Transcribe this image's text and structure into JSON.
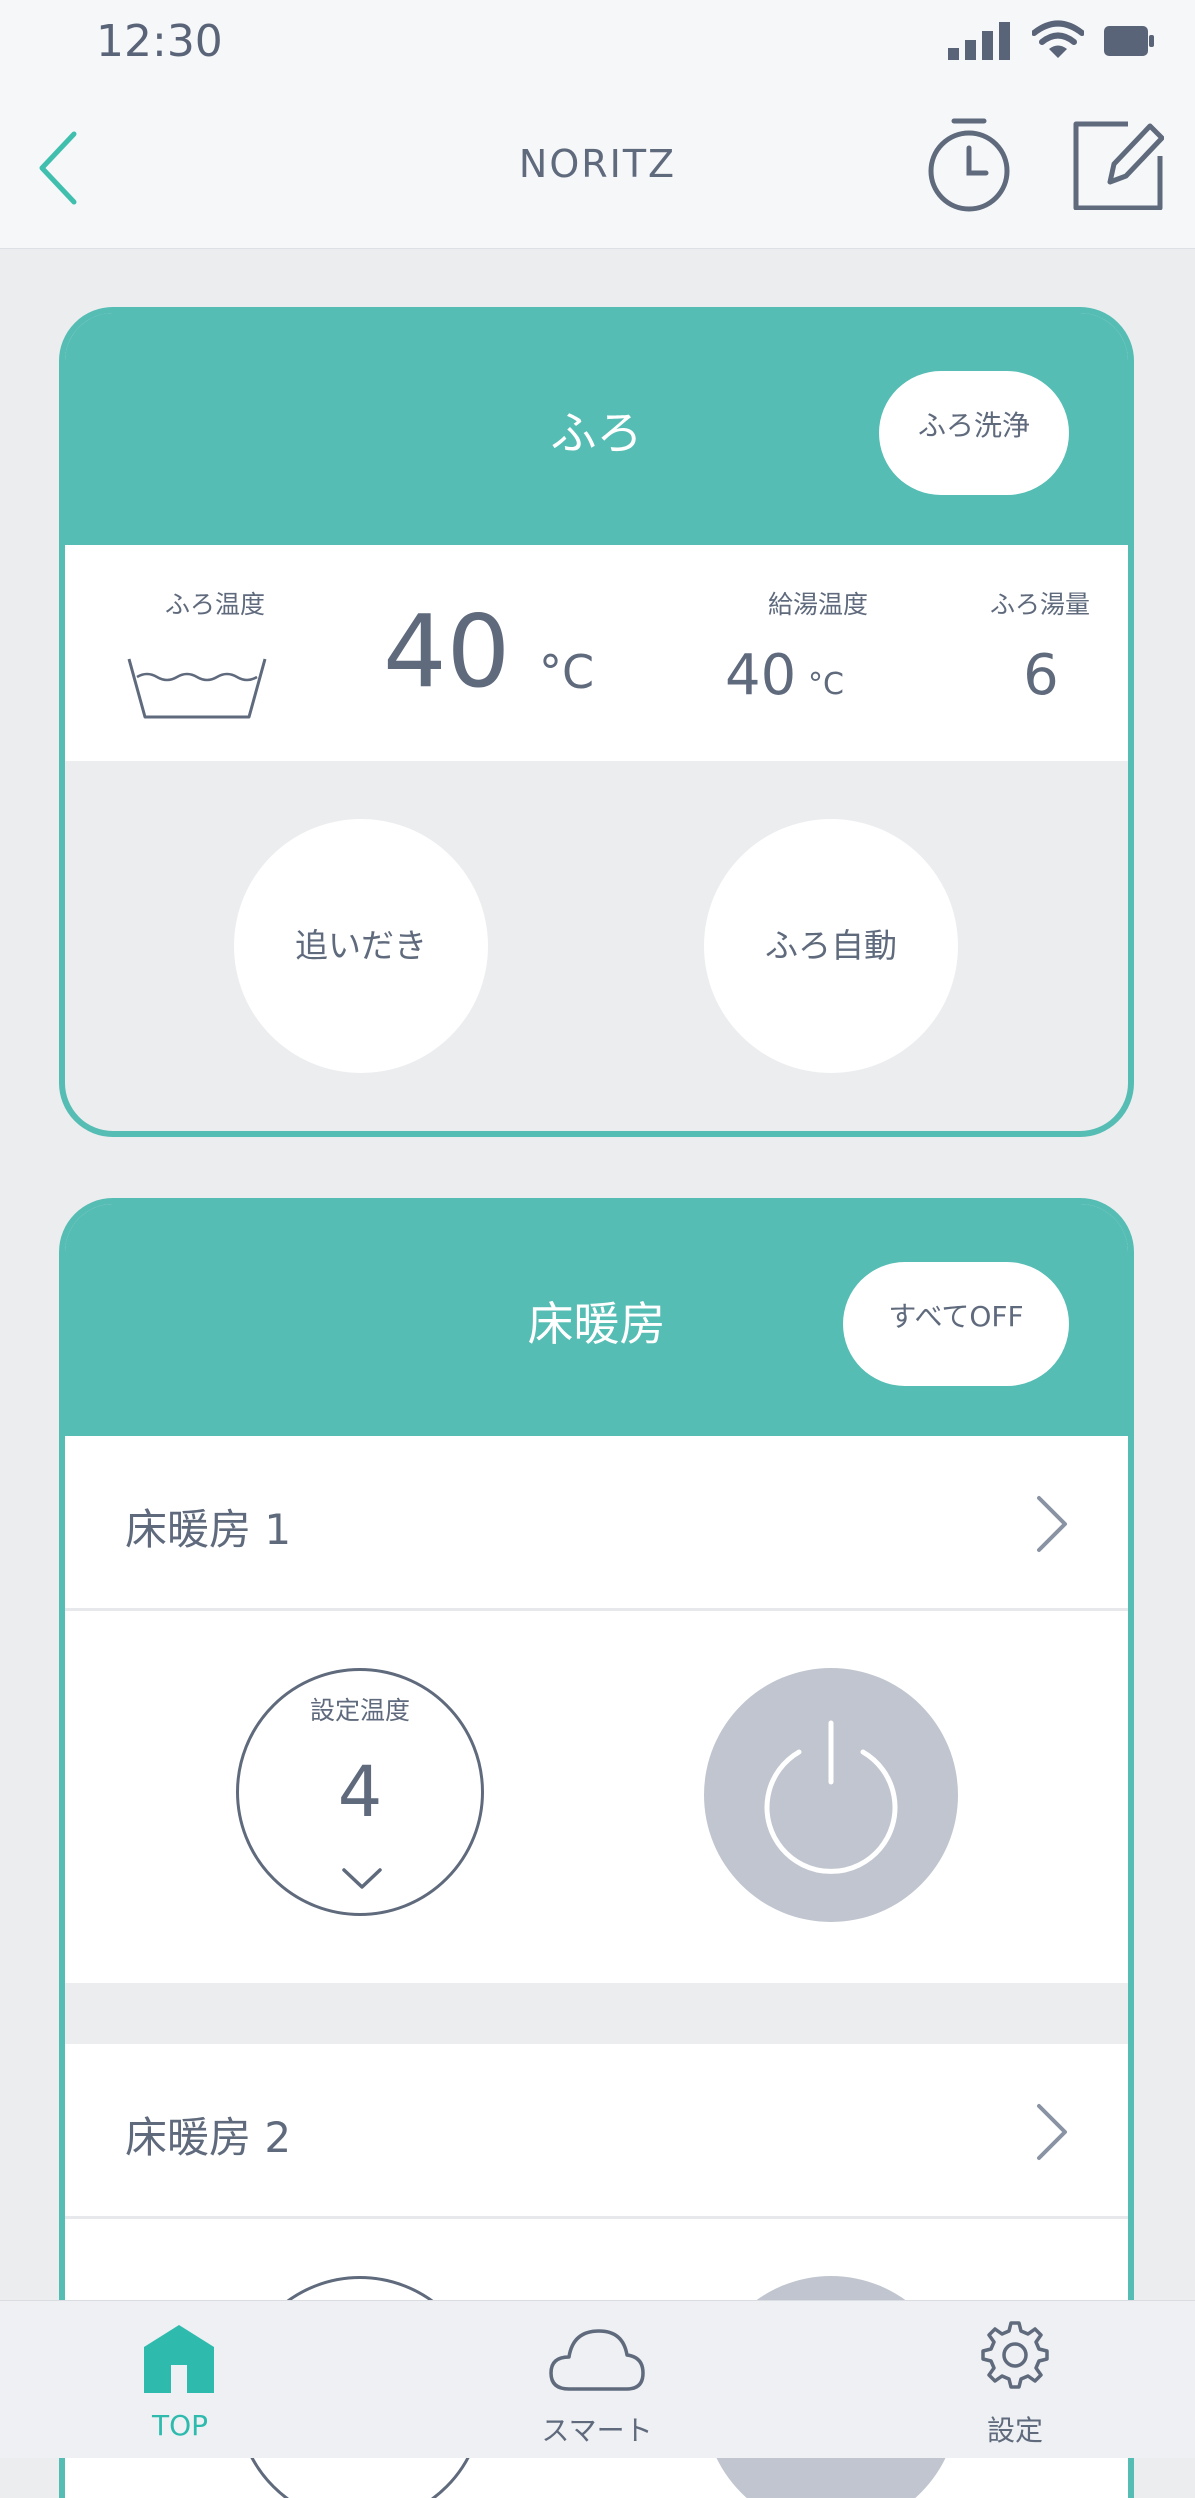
{
  "status_bar": {
    "time": "12:30"
  },
  "nav": {
    "title": "NORITZ"
  },
  "bath": {
    "title": "ふろ",
    "clean_button": "ふろ洗浄",
    "bath_temp_label": "ふろ温度",
    "bath_temp_value": "40",
    "bath_temp_unit": "°C",
    "supply_temp_label": "給湯温度",
    "supply_temp_value": "40",
    "supply_temp_unit": "°C",
    "bath_volume_label": "ふろ湯量",
    "bath_volume_value": "6",
    "reheat_button": "追いだき",
    "auto_button": "ふろ自動"
  },
  "floor_heating": {
    "title": "床暖房",
    "all_off_button": "すべてOFF",
    "zones": [
      {
        "name": "床暖房 1",
        "set_temp_label": "設定温度",
        "set_temp_value": "4"
      },
      {
        "name": "床暖房 2"
      }
    ]
  },
  "tabbar": {
    "items": [
      {
        "label": "TOP",
        "icon": "home-icon",
        "active": true
      },
      {
        "label": "スマート",
        "icon": "cloud-icon",
        "active": false
      },
      {
        "label": "設定",
        "icon": "gear-icon",
        "active": false
      }
    ],
    "active_color": "#2ebbae",
    "inactive_color": "#5f6a7d"
  },
  "colors": {
    "accent": "#55bdb4",
    "power_off": "#c0c5cf",
    "text": "#5f6a7d"
  }
}
